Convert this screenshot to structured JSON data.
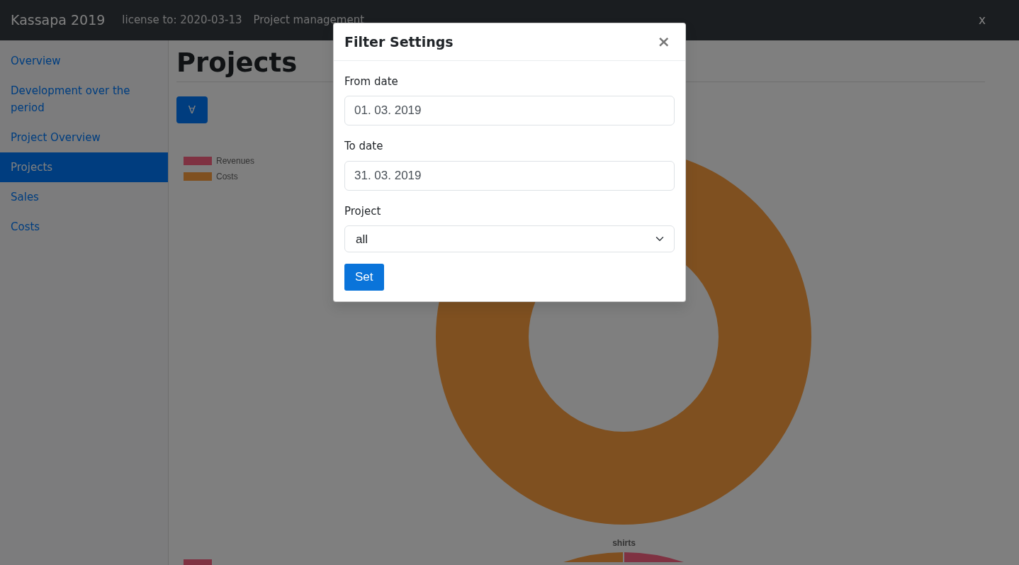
{
  "navbar": {
    "brand": "Kassapa 2019",
    "license": "license to: 2020-03-13",
    "module": "Project management",
    "close": "x"
  },
  "sidebar": {
    "items": [
      {
        "label": "Overview",
        "selected": false
      },
      {
        "label": "Development over the period",
        "selected": false
      },
      {
        "label": "Project Overview",
        "selected": false
      },
      {
        "label": "Projects",
        "selected": true
      },
      {
        "label": "Sales",
        "selected": false
      },
      {
        "label": "Costs",
        "selected": false
      }
    ]
  },
  "page": {
    "title": "Projects",
    "filter_button": "∀"
  },
  "charts": [
    {
      "kind": "donut",
      "legend": [
        {
          "label": "Revenues",
          "color": "#803242"
        },
        {
          "label": "Costs",
          "color": "#805020"
        }
      ]
    },
    {
      "kind": "donut",
      "title": "shirts",
      "legend": [
        {
          "color": "#803242"
        }
      ]
    }
  ],
  "dialog": {
    "title": "Filter Settings",
    "close": "×",
    "fields": [
      {
        "label": "From date",
        "kind": "text",
        "value": "01. 03. 2019"
      },
      {
        "label": "To date",
        "kind": "text",
        "value": "31. 03. 2019"
      },
      {
        "label": "Project",
        "kind": "select",
        "value": "all"
      }
    ],
    "button": "Set"
  }
}
